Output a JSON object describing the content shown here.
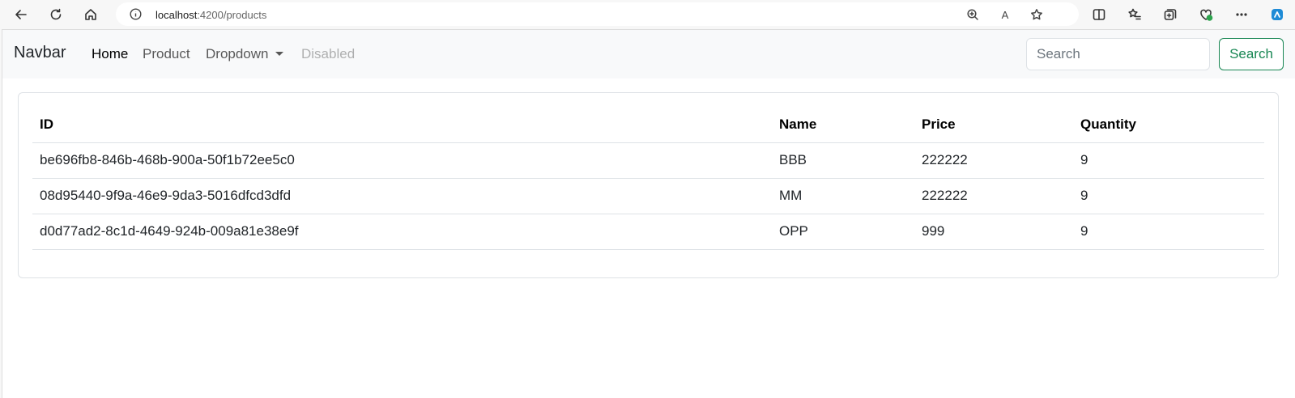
{
  "browser": {
    "url_host": "localhost",
    "url_path": ":4200/products",
    "read_aloud": "A"
  },
  "navbar": {
    "brand": "Navbar",
    "links": [
      {
        "label": "Home"
      },
      {
        "label": "Product"
      },
      {
        "label": "Dropdown"
      },
      {
        "label": "Disabled"
      }
    ],
    "search_placeholder": "Search",
    "search_button": "Search"
  },
  "table": {
    "headers": [
      "ID",
      "Name",
      "Price",
      "Quantity"
    ],
    "rows": [
      [
        "be696fb8-846b-468b-900a-50f1b72ee5c0",
        "BBB",
        "222222",
        "9"
      ],
      [
        "08d95440-9f9a-46e9-9da3-5016dfcd3dfd",
        "MM",
        "222222",
        "9"
      ],
      [
        "d0d77ad2-8c1d-4649-924b-009a81e38e9f",
        "OPP",
        "999",
        "9"
      ]
    ]
  },
  "colors": {
    "success": "#198754",
    "navbar_bg": "#f8f9fa"
  }
}
